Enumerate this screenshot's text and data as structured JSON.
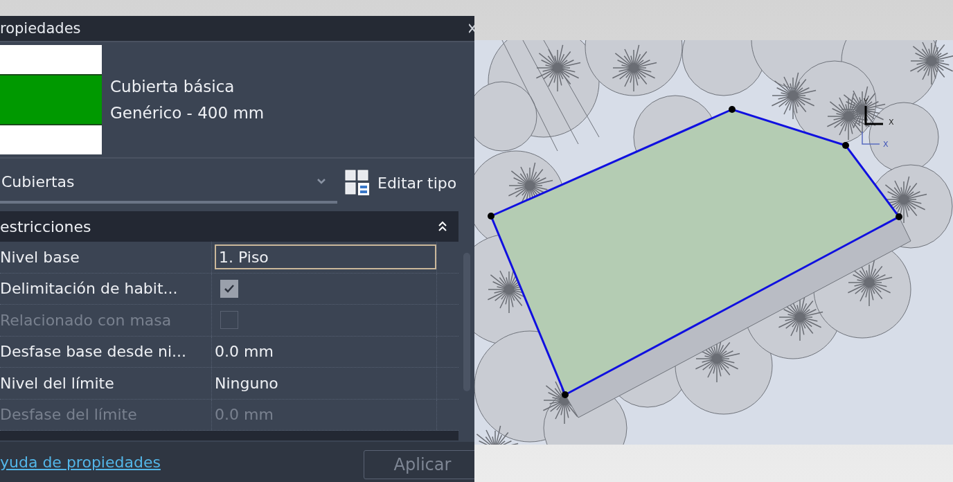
{
  "panel": {
    "title": "ropiedades",
    "type_preview": {
      "family": "Cubierta básica",
      "type": "Genérico - 400 mm"
    },
    "category_dropdown": {
      "value": "Cubiertas"
    },
    "edit_type_button": "Editar tipo",
    "section": {
      "title": "estricciones",
      "expanded": true
    },
    "properties": [
      {
        "label": "Nivel base",
        "kind": "field",
        "value": "1. Piso",
        "disabled": false
      },
      {
        "label": "Delimitación de habit...",
        "kind": "checkbox",
        "checked": true,
        "disabled": false
      },
      {
        "label": "Relacionado con masa",
        "kind": "checkbox",
        "checked": false,
        "disabled": true
      },
      {
        "label": "Desfase base desde ni...",
        "kind": "text",
        "value": "0.0 mm",
        "disabled": false
      },
      {
        "label": "Nivel del límite",
        "kind": "text",
        "value": "Ninguno",
        "disabled": false
      },
      {
        "label": "Desfase del límite",
        "kind": "text",
        "value": "0.0 mm",
        "disabled": true
      }
    ],
    "help_link": "yuda de propiedades",
    "apply_button": {
      "label": "Aplicar",
      "disabled": true
    }
  },
  "viewport": {
    "axis_labels": [
      "Y",
      "X",
      "X"
    ]
  }
}
